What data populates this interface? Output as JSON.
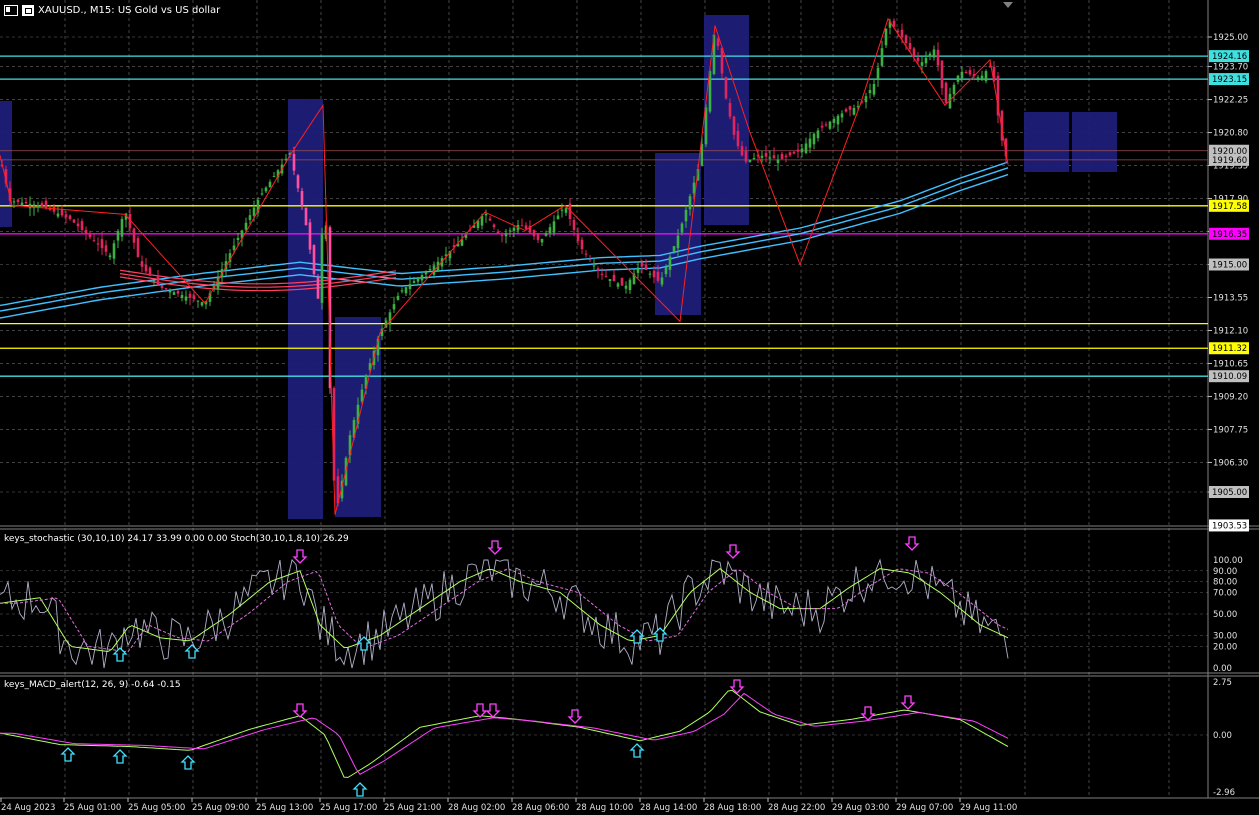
{
  "window": {
    "title": "XAUUSD., M15:  US Gold vs US dollar"
  },
  "colors": {
    "background": "#000000",
    "grid": "#c0c0c0",
    "bull": "#3cb043",
    "bear": "#e0245e",
    "zigzag": "#ff2020",
    "ema": "#40c0ff",
    "ema_red": "#ff4060",
    "cyan_line": "#40e0e0",
    "yellow_line": "#ffff00",
    "magenta_line": "#ff00ff",
    "box": "#1e1e78"
  },
  "price_axis": {
    "labels": [
      "1925.00",
      "1923.70",
      "1922.25",
      "1920.80",
      "1919.35",
      "1917.90",
      "1916.45",
      "1915.00",
      "1913.55",
      "1912.10",
      "1910.65",
      "1909.20",
      "1907.75",
      "1906.30",
      "1905.00"
    ],
    "tags": [
      {
        "label": "1924.16",
        "color": "#40e0e0",
        "text_color": "#000000"
      },
      {
        "label": "1923.15",
        "color": "#40e0e0",
        "text_color": "#000000"
      },
      {
        "label": "1920.00",
        "color": "#c0c0c0",
        "text_color": "#000000"
      },
      {
        "label": "1919.60",
        "color": "#c0c0c0",
        "text_color": "#000000"
      },
      {
        "label": "1917.58",
        "color": "#ffff00",
        "text_color": "#000000"
      },
      {
        "label": "1916.35",
        "color": "#ff00ff",
        "text_color": "#000000"
      },
      {
        "label": "1915.00",
        "color": "#c0c0c0",
        "text_color": "#000000"
      },
      {
        "label": "1911.32",
        "color": "#ffff00",
        "text_color": "#000000"
      },
      {
        "label": "1910.09",
        "color": "#c0c0c0",
        "text_color": "#000000"
      },
      {
        "label": "1905.00",
        "color": "#c0c0c0",
        "text_color": "#000000"
      },
      {
        "label": "1903.53",
        "color": "#ffffff",
        "text_color": "#000000"
      }
    ]
  },
  "stoch": {
    "title": "keys_stochastic (30,10,10) 24.17 33.99 0.00 0.00 Stoch(30,10,1,8,10) 26.29",
    "levels": [
      "100.00",
      "90.00",
      "80.00",
      "70.00",
      "50.00",
      "30.00",
      "20.00",
      "0.00"
    ]
  },
  "macd": {
    "title": "keys_MACD_alert(12, 26, 9) -0.64 -0.15",
    "levels": [
      "2.75",
      "0.00",
      "-2.96"
    ]
  },
  "time_axis": {
    "labels": [
      "24 Aug 2023",
      "25 Aug 01:00",
      "25 Aug 05:00",
      "25 Aug 09:00",
      "25 Aug 13:00",
      "25 Aug 17:00",
      "25 Aug 21:00",
      "28 Aug 02:00",
      "28 Aug 06:00",
      "28 Aug 10:00",
      "28 Aug 14:00",
      "28 Aug 18:00",
      "28 Aug 22:00",
      "29 Aug 03:00",
      "29 Aug 07:00",
      "29 Aug 11:00"
    ]
  }
}
